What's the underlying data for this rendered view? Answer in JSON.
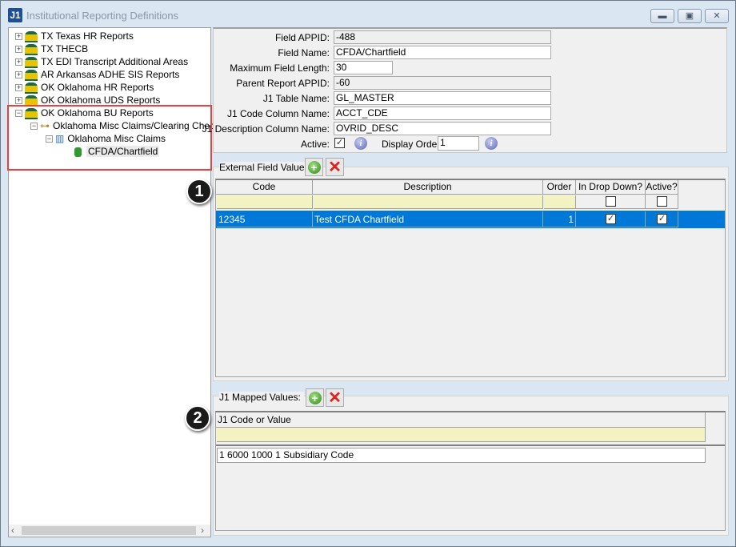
{
  "window": {
    "title": "Institutional Reporting Definitions",
    "logo": "J1",
    "minimize": "minimize-icon",
    "maximize": "restore-icon",
    "close": "close-icon"
  },
  "tree": {
    "items": [
      {
        "label": "TX Texas HR Reports",
        "expander": "+"
      },
      {
        "label": "TX THECB",
        "expander": "+"
      },
      {
        "label": "TX EDI Transcript Additional Areas",
        "expander": "+"
      },
      {
        "label": "AR Arkansas ADHE SIS Reports",
        "expander": "+"
      },
      {
        "label": "OK Oklahoma HR Reports",
        "expander": "+"
      },
      {
        "label": "OK Oklahoma UDS Reports",
        "expander": "+"
      },
      {
        "label": "OK Oklahoma BU Reports",
        "expander": "−"
      },
      {
        "label": "Oklahoma Misc Claims/Clearing Checks",
        "expander": "−"
      },
      {
        "label": "Oklahoma Misc Claims",
        "expander": "−"
      },
      {
        "label": "CFDA/Chartfield",
        "selected": true
      }
    ],
    "highlight_color": "#e94040"
  },
  "form": {
    "field_appid": {
      "label": "Field APPID:",
      "value": "-488"
    },
    "field_name": {
      "label": "Field Name:",
      "value": "CFDA/Chartfield"
    },
    "max_length": {
      "label": "Maximum Field Length:",
      "value": "30"
    },
    "parent_appid": {
      "label": "Parent Report APPID:",
      "value": "-60"
    },
    "table_name": {
      "label": "J1  Table Name:",
      "value": "GL_MASTER"
    },
    "code_column": {
      "label": "J1  Code Column Name:",
      "value": "ACCT_CDE"
    },
    "desc_column": {
      "label": "J1  Description Column Name:",
      "value": "OVRID_DESC"
    },
    "active": {
      "label": "Active:",
      "checked": true
    },
    "display_order": {
      "label": "Display Order:",
      "value": "1"
    }
  },
  "external": {
    "label": "External Field Values:",
    "columns": [
      "Code",
      "Description",
      "Order",
      "In Drop Down?",
      "Active?"
    ],
    "rows": [
      {
        "code": "12345",
        "description": "Test CFDA Chartfield",
        "order": "1",
        "in_drop_down": true,
        "active": true
      }
    ]
  },
  "mapped": {
    "label": "J1 Mapped Values:",
    "columns": [
      "J1  Code or Value"
    ],
    "rows": [
      "1    6000 1000 1   Subsidiary Code"
    ]
  },
  "badges": [
    "1",
    "2"
  ],
  "colors": {
    "selection": "#0078d7",
    "filter_row": "#f2f2c2"
  }
}
